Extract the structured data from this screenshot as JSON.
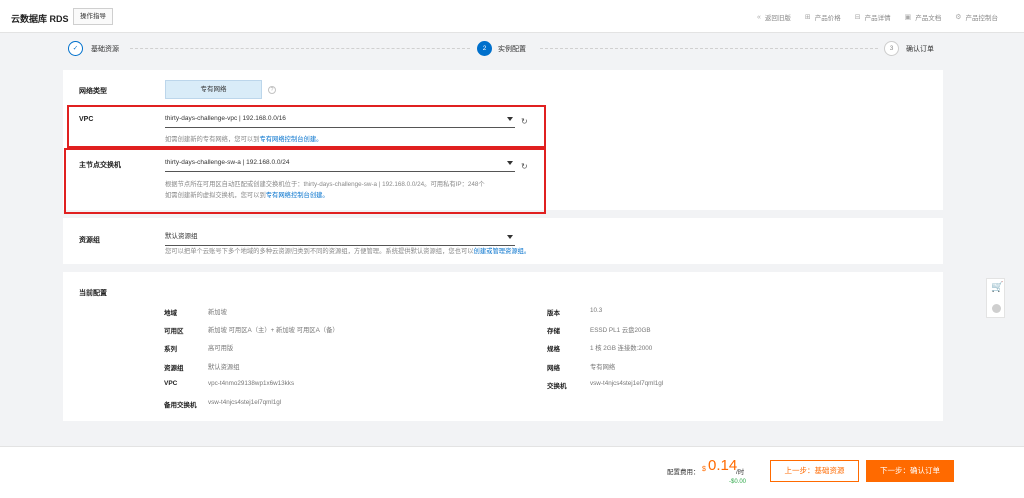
{
  "header": {
    "brand": "云数据库 RDS",
    "guide_button": "操作指导",
    "links": [
      {
        "icon": "«",
        "label": "返回旧版"
      },
      {
        "icon": "⊞",
        "label": "产品价格"
      },
      {
        "icon": "⊟",
        "label": "产品详情"
      },
      {
        "icon": "▣",
        "label": "产品文档"
      },
      {
        "icon": "⚙",
        "label": "产品控制台"
      }
    ]
  },
  "steps": [
    {
      "num": "✓",
      "label": "基础资源"
    },
    {
      "num": "2",
      "label": "实例配置"
    },
    {
      "num": "3",
      "label": "确认订单"
    }
  ],
  "network": {
    "label": "网络类型",
    "value": "专有网络",
    "help": "?"
  },
  "vpc": {
    "label": "VPC",
    "value": "thirty-days-challenge-vpc | 192.168.0.0/16",
    "hint_prefix": "如需创建新的专有网络，您可以到",
    "hint_link": "专有网络控制台创建。"
  },
  "vswitch": {
    "label": "主节点交换机",
    "value": "thirty-days-challenge-sw-a | 192.168.0.0/24",
    "hint_line1": "根据节点所在可用区自动匹配或创建交换机位于：thirty-days-challenge-sw-a | 192.168.0.0/24。可用私有IP：248个",
    "hint_line2_prefix": "如需创建新的虚拟交换机，您可以到",
    "hint_link": "专有网络控制台创建。"
  },
  "resource_group": {
    "label": "资源组",
    "value": "默认资源组",
    "hint_prefix": "您可以把单个云账号下多个地域的多种云资源归类到不同的资源组，方便管理。系统提供默认资源组，您也可以",
    "hint_link": "创建或管理资源组。"
  },
  "current_config": {
    "title": "当前配置",
    "left": [
      {
        "k": "地域",
        "v": "新加坡"
      },
      {
        "k": "可用区",
        "v": "新加坡 可用区A（主）+ 新加坡 可用区A（备）"
      },
      {
        "k": "系列",
        "v": "高可用版"
      },
      {
        "k": "资源组",
        "v": "默认资源组"
      },
      {
        "k": "VPC",
        "v": "vpc-t4nmo29138wp1x6w13kks"
      },
      {
        "k": "备用交换机",
        "v": "vsw-t4njcs4stej1el7qml1gl"
      }
    ],
    "right": [
      {
        "k": "版本",
        "v": "10.3"
      },
      {
        "k": "存储",
        "v": "ESSD PL1 云盘20GB"
      },
      {
        "k": "规格",
        "v": "1 核 2GB 连接数:2000"
      },
      {
        "k": "网络",
        "v": "专有网络"
      },
      {
        "k": "交换机",
        "v": "vsw-t4njcs4stej1el7qml1gl"
      }
    ]
  },
  "footer": {
    "fee_label": "配置费用：",
    "currency": "$",
    "price": "0.14",
    "unit": "/时",
    "discount": "-$0.00",
    "prev_button": "上一步：基础资源",
    "next_button": "下一步：确认订单"
  },
  "colors": {
    "accent": "#0070cc",
    "orange": "#ff6a00",
    "highlight_border": "#e02020"
  }
}
